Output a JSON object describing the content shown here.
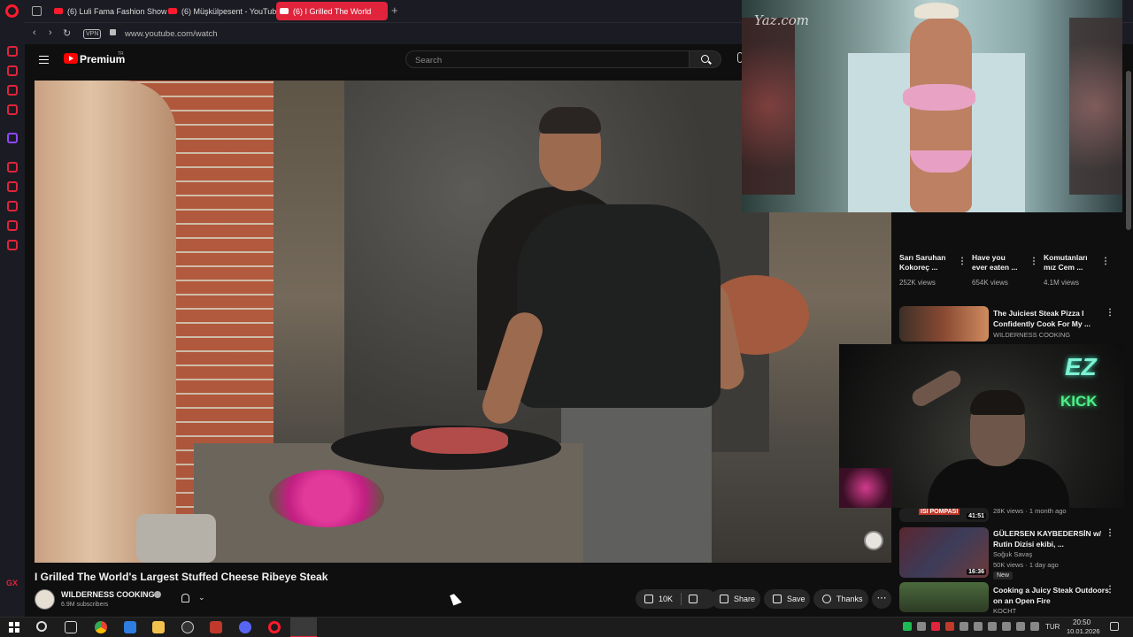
{
  "browser": {
    "tabs": [
      {
        "label": "(6) Luli Fama Fashion Show"
      },
      {
        "label": "(6) Müşkülpesent - YouTube"
      },
      {
        "label": "(6) I Grilled The World"
      }
    ],
    "vpn_label": "VPN",
    "url": "www.youtube.com/watch"
  },
  "youtube": {
    "brand": "Premium",
    "region": "TR",
    "search_placeholder": "Search"
  },
  "video": {
    "title": "I Grilled The World's Largest Stuffed Cheese Ribeye Steak",
    "channel": "WILDERNESS COOKING",
    "subscribers": "6.9M subscribers",
    "likes": "10K",
    "share_label": "Share",
    "save_label": "Save",
    "thanks_label": "Thanks"
  },
  "overlays": {
    "fashion_watermark": "Yaz.com",
    "webcam_text_1": "EZ",
    "webcam_text_2": "KICK"
  },
  "shorts": [
    {
      "title_1": "Sarı Saruhan",
      "title_2": "Kokoreç ...",
      "views": "252K views",
      "color": "#1c1c1c"
    },
    {
      "title_1": "Have you",
      "title_2": "ever eaten ...",
      "views": "654K views",
      "color": "#c0473a"
    },
    {
      "title_1": "Komutanları",
      "title_2": "mız Cem ...",
      "views": "4.1M views",
      "color": "#111111"
    }
  ],
  "recommendations": [
    {
      "title_1": "The Juiciest Steak Pizza I",
      "title_2": "Confidently Cook For My ...",
      "channel": "WILDERNESS COOKING"
    },
    {
      "partial_meta": "28K views · 1 month ago",
      "duration": "41:51",
      "thumb_text": "ISI POMPASI"
    },
    {
      "title_1": "GÜLERSEN KAYBEDERSİN w/",
      "title_2": "Rutin Dizisi ekibi, ...",
      "channel": "Soğuk Savaş",
      "meta": "50K views · 1 day ago",
      "badge": "New",
      "duration": "16:36"
    },
    {
      "title_1": "Cooking a Juicy Steak Outdoors",
      "title_2": "on an Open Fire",
      "channel": "KOCHT"
    }
  ],
  "taskbar": {
    "language": "TUR",
    "time": "20:50",
    "date": "10.01.2026"
  },
  "colors": {
    "opera_red": "#e0243b",
    "youtube_red": "#ff0000",
    "background": "#0f0f0f"
  }
}
